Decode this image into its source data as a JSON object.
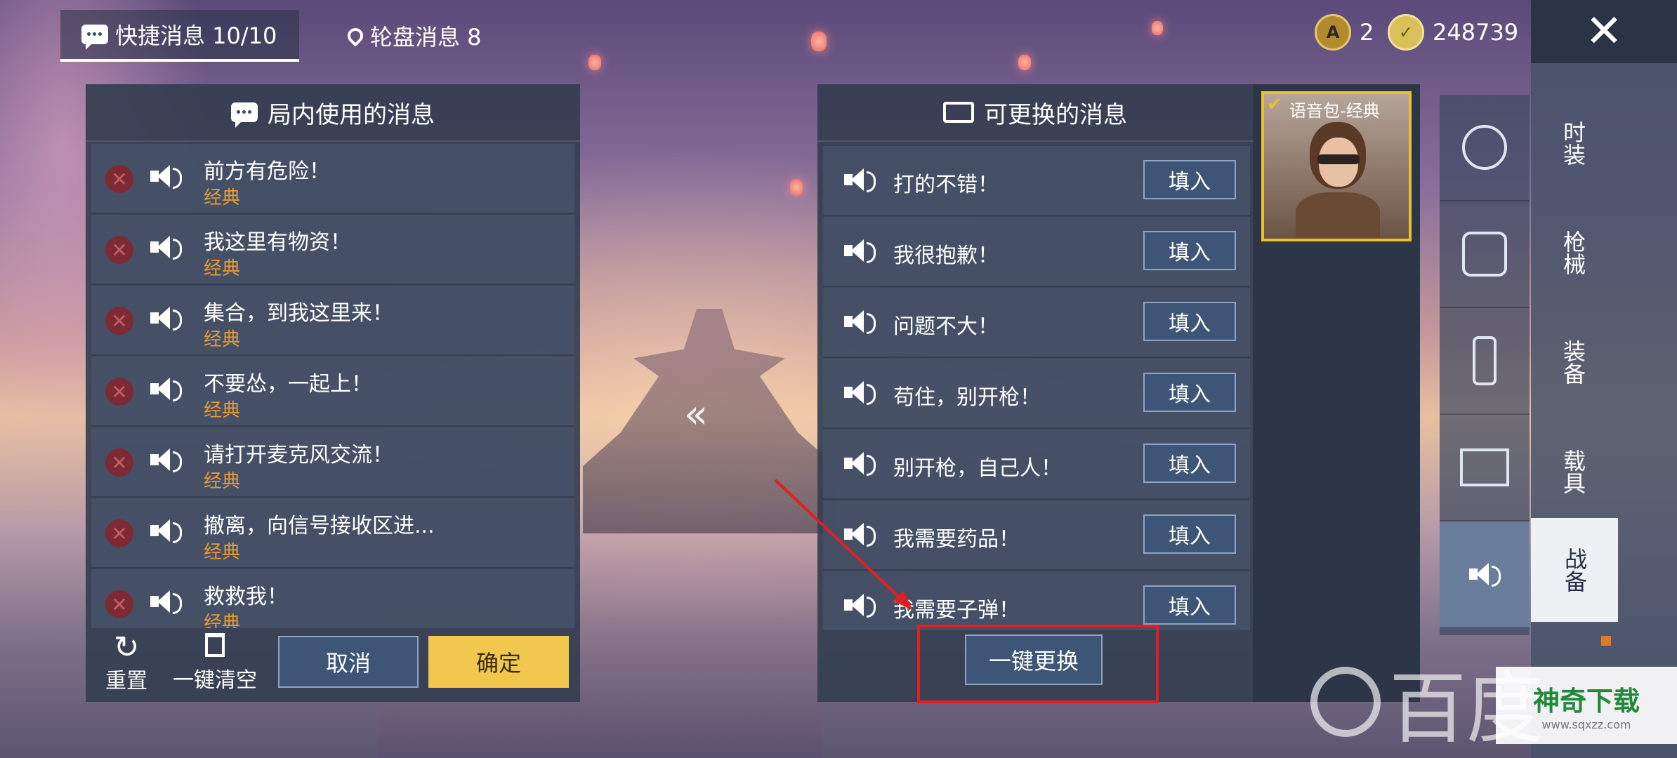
{
  "top_bar": {
    "quick_tab_label": "快捷消息 10/10",
    "wheel_tab_label": "轮盘消息 8",
    "currency1_value": "2",
    "currency2_value": "248739",
    "close_glyph": "✕"
  },
  "left_panel": {
    "title": "局内使用的消息",
    "rows": [
      {
        "text": "前方有危险！",
        "tag": "经典"
      },
      {
        "text": "我这里有物资！",
        "tag": "经典"
      },
      {
        "text": "集合，到我这里来！",
        "tag": "经典"
      },
      {
        "text": "不要怂，一起上！",
        "tag": "经典"
      },
      {
        "text": "请打开麦克风交流！",
        "tag": "经典"
      },
      {
        "text": "撤离，向信号接收区进...",
        "tag": "经典"
      },
      {
        "text": "救救我！",
        "tag": "经典"
      }
    ],
    "reset_label": "重置",
    "clear_label": "一键清空",
    "cancel_label": "取消",
    "confirm_label": "确定"
  },
  "collapse_glyph": "«",
  "right_panel": {
    "title": "可更换的消息",
    "fill_label": "填入",
    "rows": [
      "打的不错！",
      "我很抱歉！",
      "问题不大！",
      "苟住，别开枪！",
      "别开枪，自己人！",
      "我需要药品！",
      "我需要子弹！"
    ],
    "replace_all_label": "一键更换"
  },
  "voice_pack": {
    "label": "语音包-经典",
    "check_glyph": "✔"
  },
  "side_tabs": [
    {
      "label": "时装"
    },
    {
      "label": "枪械"
    },
    {
      "label": "装备"
    },
    {
      "label": "载具"
    },
    {
      "label": "战备"
    }
  ],
  "watermark": {
    "baidu_text": "百度",
    "site_text": "神奇下载",
    "site_url": "www.sqxzz.com"
  },
  "colors": {
    "confirm": "#f2c74e",
    "cancel": "#3e5577",
    "highlight_box": "#e02020",
    "tag": "#e79a3a"
  }
}
